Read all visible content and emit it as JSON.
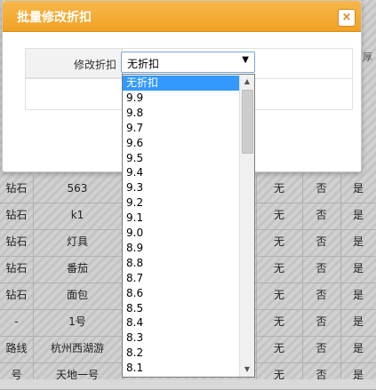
{
  "dialog": {
    "title": "批量修改折扣",
    "close_label": "×",
    "field_label": "修改折扣",
    "select_value": "无折扣"
  },
  "dropdown": {
    "options": [
      "无折扣",
      "9.9",
      "9.8",
      "9.7",
      "9.6",
      "9.5",
      "9.4",
      "9.3",
      "9.2",
      "9.1",
      "9.0",
      "8.9",
      "8.8",
      "8.7",
      "8.6",
      "8.5",
      "8.4",
      "8.3",
      "8.2",
      "8.1"
    ],
    "selected_index": 0
  },
  "background_table": {
    "rows": [
      {
        "c1": "钻石",
        "c2": "563",
        "c5": "无",
        "c6": "否",
        "c7": "是"
      },
      {
        "c1": "钻石",
        "c2": "k1",
        "c5": "无",
        "c6": "否",
        "c7": "是"
      },
      {
        "c1": "钻石",
        "c2": "灯具",
        "c5": "无",
        "c6": "否",
        "c7": "是"
      },
      {
        "c1": "钻石",
        "c2": "番茄",
        "c5": "无",
        "c6": "否",
        "c7": "是"
      },
      {
        "c1": "钻石",
        "c2": "面包",
        "c5": "无",
        "c6": "否",
        "c7": "是"
      },
      {
        "c1": "-",
        "c2": "1号",
        "c5": "无",
        "c6": "否",
        "c7": "是"
      },
      {
        "c1": "路线",
        "c2": "杭州西湖游",
        "c5": "无",
        "c6": "否",
        "c7": "是"
      },
      {
        "c1": "号",
        "c2": "天地一号",
        "c5": "无",
        "c6": "否",
        "c7": "是"
      }
    ],
    "edge_char": "厚"
  },
  "colors": {
    "header": "#f0a224",
    "selected": "#3399ff"
  }
}
